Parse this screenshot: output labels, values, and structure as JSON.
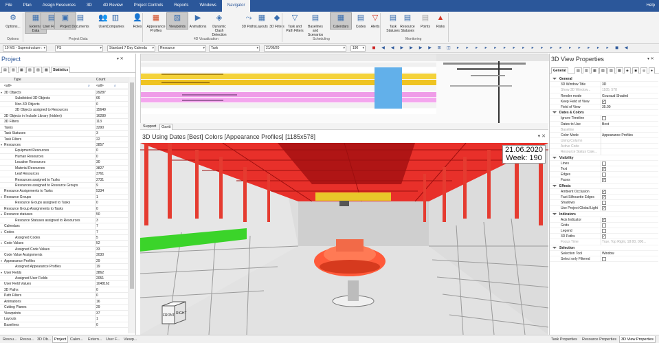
{
  "menu": {
    "tabs": [
      "File",
      "Plan",
      "Assign Resources",
      "3D",
      "4D Review",
      "Project Controls",
      "Reports",
      "Windows",
      "Navigator"
    ],
    "active": "Navigator",
    "help": "Help"
  },
  "ribbon": {
    "buttons": [
      {
        "label": "Options...",
        "icon": "options-icon",
        "color": "#3a6fb0",
        "glyph": "⚙"
      },
      {
        "label": "External Data",
        "icon": "external-data-icon",
        "color": "#3a6fb0",
        "glyph": "▦"
      },
      {
        "label": "User Fields",
        "icon": "user-fields-icon",
        "color": "#3a6fb0",
        "glyph": "▤"
      },
      {
        "label": "Project",
        "icon": "project-icon",
        "color": "#3a6fb0",
        "glyph": "▣"
      },
      {
        "label": "Documents",
        "icon": "documents-icon",
        "color": "#3a6fb0",
        "glyph": "▤"
      },
      {
        "label": "Users",
        "icon": "users-icon",
        "color": "#3a6fb0",
        "glyph": "👥"
      },
      {
        "label": "Companies",
        "icon": "companies-icon",
        "color": "#3a6fb0",
        "glyph": "▥"
      },
      {
        "label": "Roles",
        "icon": "roles-icon",
        "color": "#3a6fb0",
        "glyph": "👤"
      },
      {
        "label": "Appearance Profiles",
        "icon": "appearance-profiles-icon",
        "color": "#d4502a",
        "glyph": "▦"
      },
      {
        "label": "Viewpoints",
        "icon": "viewpoints-icon",
        "color": "#3a6fb0",
        "glyph": "▧"
      },
      {
        "label": "Animations",
        "icon": "animations-icon",
        "color": "#3a6fb0",
        "glyph": "▶"
      },
      {
        "label": "Dynamic Clash Detection",
        "icon": "clash-detection-icon",
        "color": "#3a6fb0",
        "glyph": "◈"
      },
      {
        "label": "3D Paths",
        "icon": "paths-icon",
        "color": "#3a6fb0",
        "glyph": "⤳"
      },
      {
        "label": "Layouts",
        "icon": "layouts-icon",
        "color": "#3a6fb0",
        "glyph": "▦"
      },
      {
        "label": "3D Filters",
        "icon": "filters-3d-icon",
        "color": "#3a6fb0",
        "glyph": "◆"
      },
      {
        "label": "Task and Path Filters",
        "icon": "task-filter-icon",
        "color": "#3a6fb0",
        "glyph": "▽"
      },
      {
        "label": "Baselines and Scenarios",
        "icon": "baselines-icon",
        "color": "#3a6fb0",
        "glyph": "▤"
      },
      {
        "label": "Calendars",
        "icon": "calendars-icon",
        "color": "#3a6fb0",
        "glyph": "▦"
      },
      {
        "label": "Codes",
        "icon": "codes-icon",
        "color": "#3a6fb0",
        "glyph": "▤"
      },
      {
        "label": "Alerts",
        "icon": "alerts-icon",
        "color": "#d43a2a",
        "glyph": "▽"
      },
      {
        "label": "Task Statuses",
        "icon": "task-statuses-icon",
        "color": "#3a6fb0",
        "glyph": "▤"
      },
      {
        "label": "Resource Statuses",
        "icon": "resource-statuses-icon",
        "color": "#3a6fb0",
        "glyph": "▤"
      },
      {
        "label": "Points",
        "icon": "points-icon",
        "color": "#aaaaaa",
        "glyph": "▤"
      },
      {
        "label": "Risks",
        "icon": "risks-icon",
        "color": "#d43a2a",
        "glyph": "▲"
      }
    ],
    "groups": [
      "Options",
      "Project Data",
      "4D Visualization",
      "Scheduling",
      "Monitoring"
    ]
  },
  "toolbar": {
    "combo1": "10 MS - Superstructure :",
    "combo2": "FS",
    "combo3": "Standard 7 Day Calenda",
    "combo4": "Resource",
    "combo5": "Task",
    "date": "21/06/20",
    "week": "190"
  },
  "project_panel": {
    "title": "Project",
    "tab": "Statistics",
    "col_type": "Type",
    "col_count": "Count",
    "filter_all": "<all>",
    "filter_all2": "<all>",
    "rows": [
      {
        "t": "3D Objects",
        "c": "29287",
        "ind": false,
        "ex": true
      },
      {
        "t": "Subdivided 3D Objects",
        "c": "66",
        "ind": true
      },
      {
        "t": "Non-3D Objects",
        "c": "0",
        "ind": true
      },
      {
        "t": "3D Objects assigned to Resources",
        "c": "15649",
        "ind": true
      },
      {
        "t": "3D Objects in Include Library (hidden)",
        "c": "16280",
        "ind": false
      },
      {
        "t": "3D Filters",
        "c": "113",
        "ind": false
      },
      {
        "t": "Tasks",
        "c": "3290",
        "ind": false
      },
      {
        "t": "Task Statuses",
        "c": "3",
        "ind": false
      },
      {
        "t": "Task Filters",
        "c": "22",
        "ind": false
      },
      {
        "t": "Resources",
        "c": "3857",
        "ind": false,
        "ex": true
      },
      {
        "t": "Equipment Resources",
        "c": "0",
        "ind": true
      },
      {
        "t": "Human Resources",
        "c": "0",
        "ind": true
      },
      {
        "t": "Location Resources",
        "c": "30",
        "ind": true
      },
      {
        "t": "Material Resources",
        "c": "3827",
        "ind": true
      },
      {
        "t": "Leaf Resources",
        "c": "3761",
        "ind": true
      },
      {
        "t": "Resources assigned to Tasks",
        "c": "2731",
        "ind": true
      },
      {
        "t": "Resources assigned to Resource Groups",
        "c": "9",
        "ind": true
      },
      {
        "t": "Resource Assignments to Tasks",
        "c": "5334",
        "ind": false
      },
      {
        "t": "Resource Groups",
        "c": "1",
        "ind": false,
        "ex": true
      },
      {
        "t": "Resource Groups assigned to Tasks",
        "c": "0",
        "ind": true
      },
      {
        "t": "Resource Group Assignments to Tasks",
        "c": "0",
        "ind": false
      },
      {
        "t": "Resource statuses",
        "c": "50",
        "ind": false,
        "ex": true
      },
      {
        "t": "Resource Statuses assigned to Resources",
        "c": "3",
        "ind": true
      },
      {
        "t": "Calendars",
        "c": "7",
        "ind": false
      },
      {
        "t": "Codes",
        "c": "7",
        "ind": false,
        "ex": true
      },
      {
        "t": "Assigned Codes",
        "c": "5",
        "ind": true
      },
      {
        "t": "Code Values",
        "c": "52",
        "ind": false,
        "ex": true
      },
      {
        "t": "Assigned Code Values",
        "c": "33",
        "ind": true
      },
      {
        "t": "Code Value Assignments",
        "c": "3030",
        "ind": false
      },
      {
        "t": "Appearance Profiles",
        "c": "29",
        "ind": false,
        "ex": true
      },
      {
        "t": "Assigned Appearance Profiles",
        "c": "19",
        "ind": true
      },
      {
        "t": "User Fields",
        "c": "3862",
        "ind": false,
        "ex": true
      },
      {
        "t": "Assigned User Fields",
        "c": "2051",
        "ind": true
      },
      {
        "t": "User Field Values",
        "c": "1048162",
        "ind": false
      },
      {
        "t": "3D Paths",
        "c": "0",
        "ind": false
      },
      {
        "t": "Path Filters",
        "c": "0",
        "ind": false
      },
      {
        "t": "Animations",
        "c": "16",
        "ind": false
      },
      {
        "t": "Cutting Planes",
        "c": "29",
        "ind": false
      },
      {
        "t": "Viewpoints",
        "c": "37",
        "ind": false
      },
      {
        "t": "Layouts",
        "c": "1",
        "ind": false
      },
      {
        "t": "Baselines",
        "c": "0",
        "ind": false
      }
    ]
  },
  "bottom_tabs": {
    "left": [
      "Resou...",
      "Resou...",
      "3D Ob...",
      "Project",
      "Calen...",
      "Extern...",
      "User F...",
      "Viewp..."
    ],
    "left_active": "Project",
    "right": [
      "Task Properties",
      "Resource Properties",
      "3D View Properties"
    ],
    "right_active": "3D View Properties"
  },
  "gantt": {
    "tabs": [
      "Support",
      "Gantt"
    ],
    "active": "Gantt"
  },
  "view3d": {
    "title": "3D Using Dates [Best] Colors [Appearance Profiles]  [1185x578]",
    "date": "21.06.2020",
    "week": "Week: 190",
    "cube_front": "FRONT",
    "cube_right": "RIGHT"
  },
  "props_panel": {
    "title": "3D View Properties",
    "tab": "General",
    "rows": [
      {
        "k": "General",
        "cat": true
      },
      {
        "k": "3D Window Title",
        "v": "3D"
      },
      {
        "k": "Show 3D Window...",
        "v": "1185, 578",
        "dis": true
      },
      {
        "k": "Render mode",
        "v": "Gouraud Shaded"
      },
      {
        "k": "Keep Field of View",
        "cb": true,
        "chk": true
      },
      {
        "k": "Field of View",
        "v": "35.00"
      },
      {
        "k": "Dates & Colors",
        "cat": true
      },
      {
        "k": "Ignore Timeline",
        "cb": true,
        "chk": false
      },
      {
        "k": "Dates to Use",
        "v": "Best"
      },
      {
        "k": "Baseline",
        "dis": true
      },
      {
        "k": "Color Mode",
        "v": "Appearance Profiles"
      },
      {
        "k": "Using Column",
        "dis": true
      },
      {
        "k": "Active Code",
        "dis": true
      },
      {
        "k": "Resource Status Cate...",
        "dis": true
      },
      {
        "k": "Visibility",
        "cat": true
      },
      {
        "k": "Lines",
        "cb": true,
        "chk": false
      },
      {
        "k": "Text",
        "cb": true,
        "chk": true
      },
      {
        "k": "Edges",
        "cb": true,
        "chk": false
      },
      {
        "k": "Faces",
        "cb": true,
        "chk": true
      },
      {
        "k": "Effects",
        "cat": true
      },
      {
        "k": "Ambient Occlusion",
        "cb": true,
        "chk": true
      },
      {
        "k": "Fast Silhouette Edges",
        "cb": true,
        "chk": true
      },
      {
        "k": "Shadows",
        "cb": true,
        "chk": false
      },
      {
        "k": "Use Project Global Light",
        "cb": true,
        "chk": true
      },
      {
        "k": "Indicators",
        "cat": true
      },
      {
        "k": "Axis Indicator",
        "cb": true,
        "chk": true
      },
      {
        "k": "Grids",
        "cb": true,
        "chk": false
      },
      {
        "k": "Legend",
        "cb": true,
        "chk": false
      },
      {
        "k": "3D Paths",
        "cb": true,
        "chk": true
      },
      {
        "k": "Focus Time",
        "v": "True, Top Right, 18:00, 000...",
        "dis": true
      },
      {
        "k": "Selection",
        "cat": true
      },
      {
        "k": "Selection Tool",
        "v": "Window"
      },
      {
        "k": "Select only Filtered",
        "cb": true,
        "chk": false
      }
    ]
  }
}
